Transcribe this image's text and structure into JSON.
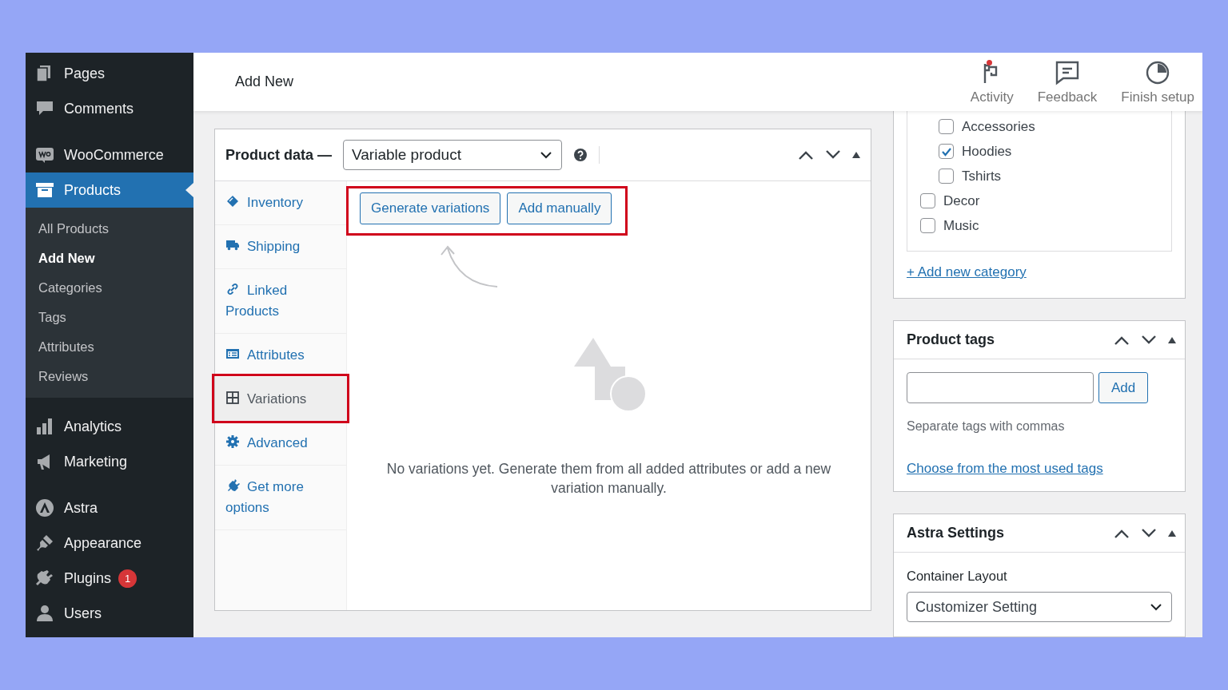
{
  "sidebar": {
    "groups": [
      {
        "items": [
          {
            "label": "Pages",
            "selected": false
          },
          {
            "label": "Comments",
            "selected": false
          }
        ]
      },
      {
        "items": [
          {
            "label": "WooCommerce",
            "selected": false
          },
          {
            "label": "Products",
            "selected": true,
            "children": [
              {
                "label": "All Products",
                "selected": false
              },
              {
                "label": "Add New",
                "selected": true
              },
              {
                "label": "Categories",
                "selected": false
              },
              {
                "label": "Tags",
                "selected": false
              },
              {
                "label": "Attributes",
                "selected": false
              },
              {
                "label": "Reviews",
                "selected": false
              }
            ]
          }
        ]
      },
      {
        "items": [
          {
            "label": "Analytics",
            "selected": false
          },
          {
            "label": "Marketing",
            "selected": false
          }
        ]
      },
      {
        "items": [
          {
            "label": "Astra",
            "selected": false
          },
          {
            "label": "Appearance",
            "selected": false
          },
          {
            "label": "Plugins",
            "selected": false,
            "badge": "1"
          },
          {
            "label": "Users",
            "selected": false
          }
        ]
      }
    ]
  },
  "header": {
    "title": "Add New",
    "actions": [
      {
        "label": "Activity",
        "notification": true
      },
      {
        "label": "Feedback",
        "notification": false
      },
      {
        "label": "Finish setup",
        "notification": false
      }
    ]
  },
  "product_data": {
    "title": "Product data —",
    "product_type": "Variable product",
    "tabs": [
      {
        "label": "Inventory",
        "selected": false,
        "highlighted": false
      },
      {
        "label": "Shipping",
        "selected": false,
        "highlighted": false
      },
      {
        "label": "Linked Products",
        "selected": false,
        "highlighted": false
      },
      {
        "label": "Attributes",
        "selected": false,
        "highlighted": false
      },
      {
        "label": "Variations",
        "selected": true,
        "highlighted": true
      },
      {
        "label": "Advanced",
        "selected": false,
        "highlighted": false
      },
      {
        "label": "Get more options",
        "selected": false,
        "highlighted": false
      }
    ],
    "actions": {
      "highlighted": true,
      "buttons": [
        "Generate variations",
        "Add manually"
      ]
    },
    "empty_message": "No variations yet. Generate them from all added attributes or add a new variation manually."
  },
  "categories": {
    "items": [
      {
        "children": [
          {
            "label": "Accessories",
            "checked": false
          },
          {
            "label": "Hoodies",
            "checked": true
          },
          {
            "label": "Tshirts",
            "checked": false
          }
        ]
      },
      {
        "label": "Decor",
        "checked": false
      },
      {
        "label": "Music",
        "checked": false
      }
    ],
    "add_link": "+ Add new category"
  },
  "product_tags": {
    "title": "Product tags",
    "add_button": "Add",
    "hint": "Separate tags with commas",
    "link": "Choose from the most used tags"
  },
  "astra_settings": {
    "title": "Astra Settings",
    "field_label": "Container Layout",
    "value": "Customizer Setting"
  }
}
